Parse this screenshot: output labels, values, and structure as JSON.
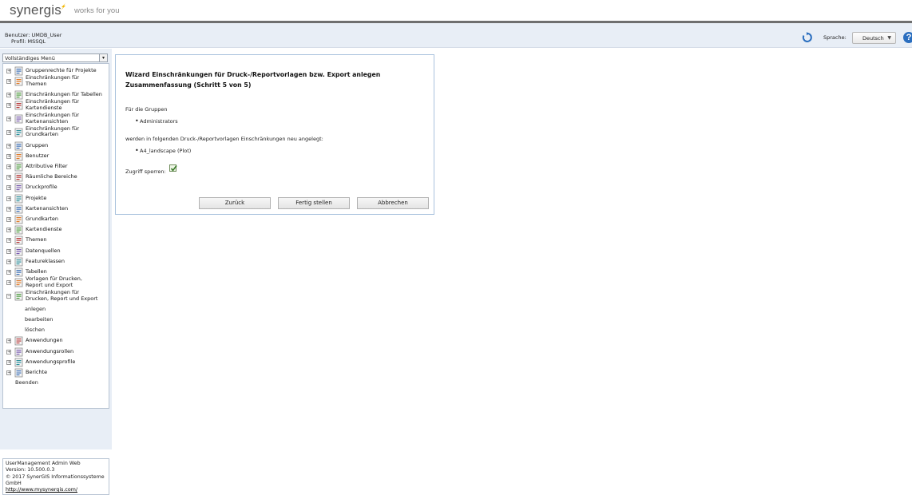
{
  "brand": {
    "logo": "synergis",
    "tagline": "works for you",
    "accent": "#f2b705"
  },
  "user": {
    "line1": "Benutzer: UMDB_User",
    "line2": "Profil: MSSQL"
  },
  "header": {
    "language_label": "Sprache:",
    "language_value": "Deutsch",
    "help": "?"
  },
  "sidebar": {
    "menu_select": "Vollständiges Menü",
    "items": [
      {
        "label": "Gruppenrechte für Projekte",
        "icon": "group-rights-icon"
      },
      {
        "label": "Einschränkungen für\nThemen",
        "icon": "restrict-themes-icon"
      },
      {
        "label": "Einschränkungen für Tabellen",
        "icon": "restrict-tables-icon"
      },
      {
        "label": "Einschränkungen für\nKartendienste",
        "icon": "restrict-mapservices-icon"
      },
      {
        "label": "Einschränkungen für\nKartenansichten",
        "icon": "restrict-mapviews-icon"
      },
      {
        "label": "Einschränkungen für\nGrundkarten",
        "icon": "restrict-basemaps-icon"
      },
      {
        "label": "Gruppen",
        "icon": "groups-icon"
      },
      {
        "label": "Benutzer",
        "icon": "user-icon"
      },
      {
        "label": "Attributive Filter",
        "icon": "filter-icon"
      },
      {
        "label": "Räumliche Bereiche",
        "icon": "spatial-area-icon"
      },
      {
        "label": "Druckprofile",
        "icon": "printer-icon"
      },
      {
        "label": "Projekte",
        "icon": "projects-icon"
      },
      {
        "label": "Kartenansichten",
        "icon": "mapviews-icon"
      },
      {
        "label": "Grundkarten",
        "icon": "basemaps-icon"
      },
      {
        "label": "Kartendienste",
        "icon": "mapservices-icon"
      },
      {
        "label": "Themen",
        "icon": "themes-icon"
      },
      {
        "label": "Datenquellen",
        "icon": "datasource-icon"
      },
      {
        "label": "Featureklassen",
        "icon": "featureclass-icon"
      },
      {
        "label": "Tabellen",
        "icon": "table-icon"
      },
      {
        "label": "Vorlagen für Drucken,\nReport und Export",
        "icon": "templates-icon"
      },
      {
        "label": "Einschränkungen für\nDrucken, Report und Export",
        "icon": "restrict-print-icon",
        "expanded": true
      }
    ],
    "subitems": [
      "anlegen",
      "bearbeiten",
      "löschen"
    ],
    "items_after": [
      {
        "label": "Anwendungen",
        "icon": "applications-icon"
      },
      {
        "label": "Anwendungsrollen",
        "icon": "app-roles-icon"
      },
      {
        "label": "Anwendungsprofile",
        "icon": "app-profiles-icon"
      },
      {
        "label": "Berichte",
        "icon": "reports-icon"
      }
    ],
    "exit": "Beenden",
    "footer": {
      "line1": "UserManagement Admin Web",
      "line2": "Version: 10.500.0.3",
      "line3": "© 2017 SynerGIS Informationssysteme",
      "line4": "GmbH",
      "link": "http://www.mysynergis.com/"
    }
  },
  "wizard": {
    "title_line1": "Wizard Einschränkungen für Druck-/Reportvorlagen bzw. Export anlegen",
    "title_line2": "Zusammenfassung (Schritt 5 von 5)",
    "groups_label": "Für die Gruppen",
    "group": "Administrators",
    "templates_label": "werden in folgenden Druck-/Reportvorlagen Einschränkungen neu angelegt:",
    "template": "A4_landscape (Plot)",
    "access_label": "Zugriff sperren:",
    "access_checked": true,
    "buttons": {
      "back": "Zurück",
      "finish": "Fertig stellen",
      "cancel": "Abbrechen"
    }
  }
}
